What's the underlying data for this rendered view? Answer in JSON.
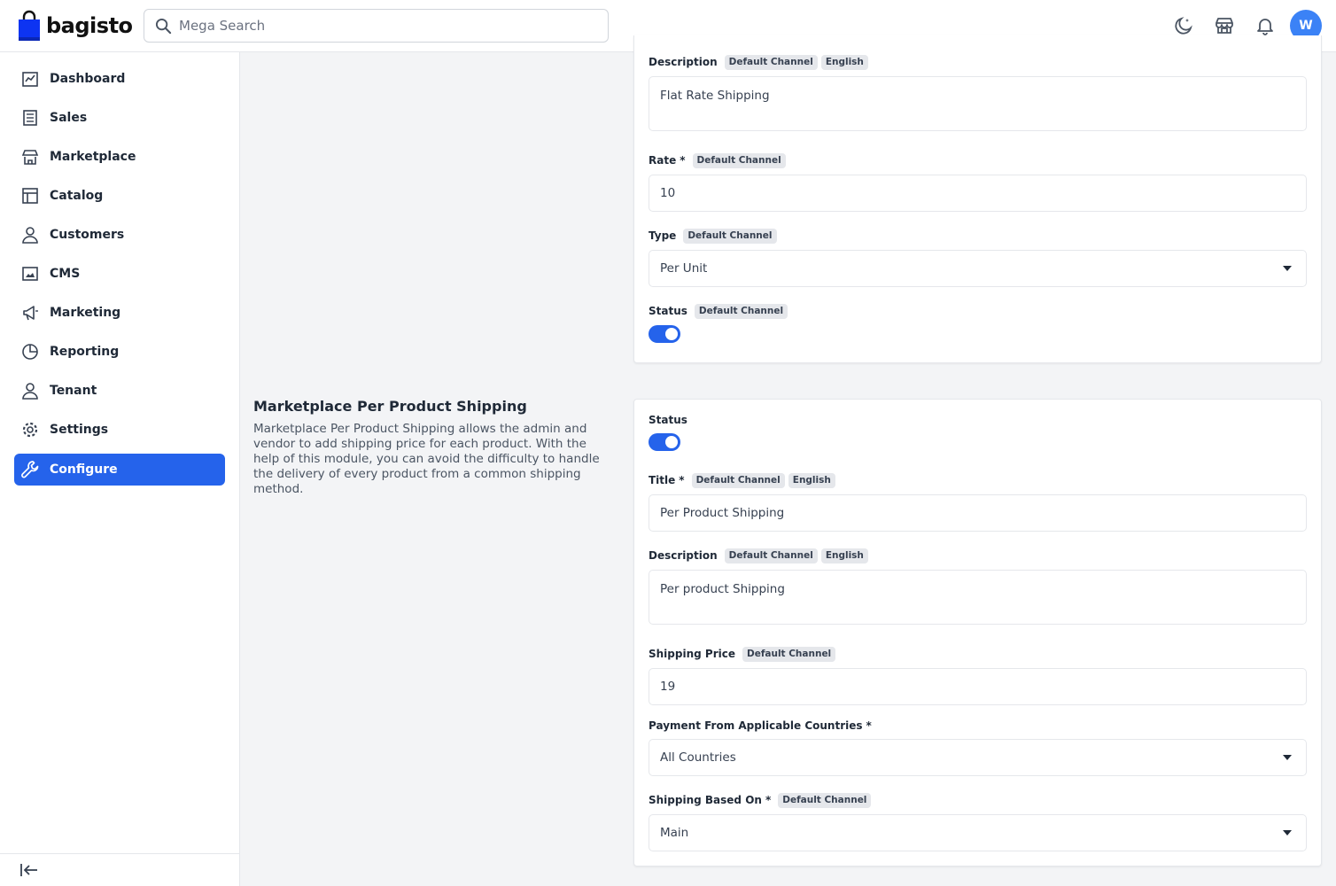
{
  "header": {
    "brand": "bagisto",
    "search_placeholder": "Mega Search",
    "avatar_initial": "W"
  },
  "sidebar": {
    "items": [
      {
        "label": "Dashboard",
        "icon": "dashboard-icon"
      },
      {
        "label": "Sales",
        "icon": "sales-icon"
      },
      {
        "label": "Marketplace",
        "icon": "store-icon"
      },
      {
        "label": "Catalog",
        "icon": "catalog-icon"
      },
      {
        "label": "Customers",
        "icon": "customer-icon"
      },
      {
        "label": "CMS",
        "icon": "cms-icon"
      },
      {
        "label": "Marketing",
        "icon": "megaphone-icon"
      },
      {
        "label": "Reporting",
        "icon": "pie-chart-icon"
      },
      {
        "label": "Tenant",
        "icon": "user-icon"
      },
      {
        "label": "Settings",
        "icon": "gear-icon"
      },
      {
        "label": "Configure",
        "icon": "wrench-icon",
        "active": true
      }
    ]
  },
  "flat_rate": {
    "description_label": "Description",
    "description_badges": [
      "Default Channel",
      "English"
    ],
    "description_value": "Flat Rate Shipping",
    "rate_label": "Rate",
    "rate_required": "*",
    "rate_badge": "Default Channel",
    "rate_value": "10",
    "type_label": "Type",
    "type_badge": "Default Channel",
    "type_value": "Per Unit",
    "status_label": "Status",
    "status_badge": "Default Channel",
    "status_on": true
  },
  "per_product": {
    "section_title": "Marketplace Per Product Shipping",
    "section_description": "Marketplace Per Product Shipping allows the admin and vendor to add shipping price for each product. With the help of this module, you can avoid the difficulty to handle the delivery of every product from a common shipping method.",
    "status_label": "Status",
    "status_on": true,
    "title_label": "Title",
    "title_required": "*",
    "title_badges": [
      "Default Channel",
      "English"
    ],
    "title_value": "Per Product Shipping",
    "description_label": "Description",
    "description_badges": [
      "Default Channel",
      "English"
    ],
    "description_value": "Per product Shipping",
    "shipping_price_label": "Shipping Price",
    "shipping_price_badge": "Default Channel",
    "shipping_price_value": "19",
    "countries_label": "Payment From Applicable Countries",
    "countries_required": "*",
    "countries_value": "All Countries",
    "based_on_label": "Shipping Based On",
    "based_on_required": "*",
    "based_on_badge": "Default Channel",
    "based_on_value": "Main"
  },
  "colors": {
    "accent": "#2563eb",
    "avatar": "#3b82f6"
  }
}
